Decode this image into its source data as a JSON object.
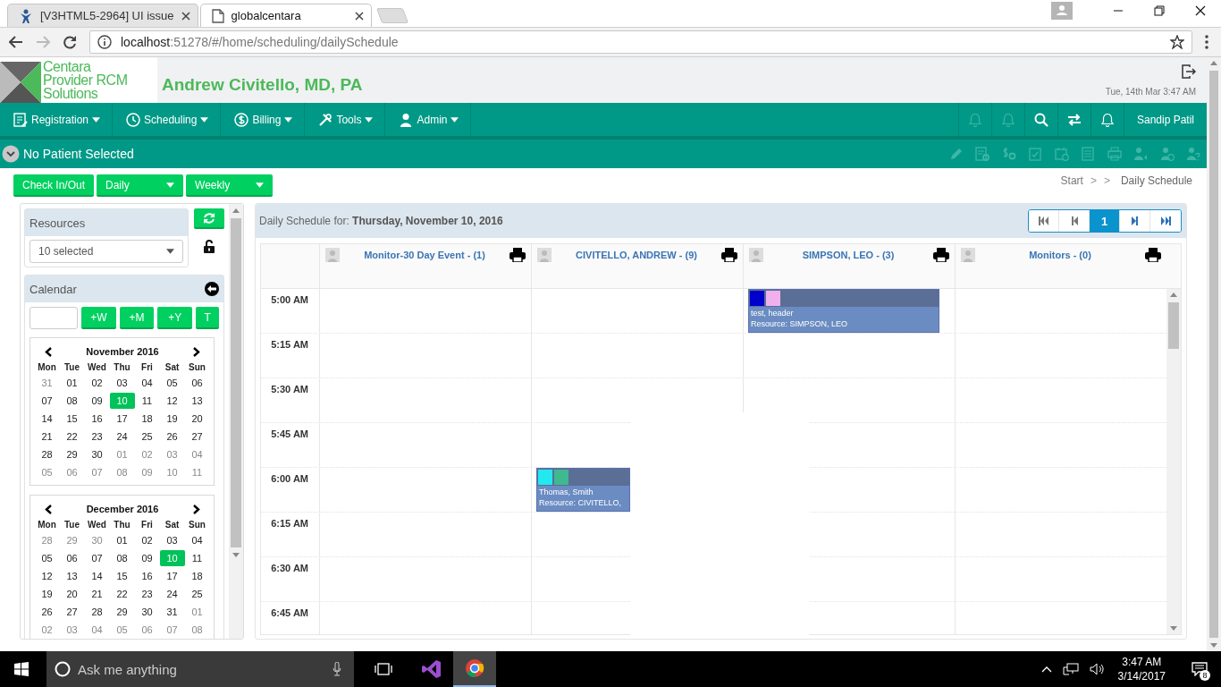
{
  "browser": {
    "tabs": [
      {
        "title": "[V3HTML5-2964] UI issue",
        "selected": false
      },
      {
        "title": "globalcentara",
        "selected": true
      }
    ],
    "url_host": "localhost",
    "url_path": ":51278/#/home/scheduling/dailySchedule"
  },
  "header": {
    "logo_lines": [
      "Centara",
      "Provider RCM",
      "Solutions"
    ],
    "practice": "Andrew Civitello, MD, PA",
    "datetime": "Tue, 14th Mar 3:47 AM"
  },
  "nav": {
    "menus": [
      {
        "label": "Registration"
      },
      {
        "label": "Scheduling"
      },
      {
        "label": "Billing"
      },
      {
        "label": "Tools"
      },
      {
        "label": "Admin"
      }
    ],
    "user": "Sandip Patil"
  },
  "patient_bar": {
    "text": "No Patient Selected"
  },
  "toolbar": {
    "button": "Check In/Out",
    "views": [
      {
        "label": "Daily"
      },
      {
        "label": "Weekly"
      }
    ]
  },
  "breadcrumbs": [
    {
      "kind": "link",
      "text": "Start"
    },
    {
      "kind": "sep",
      "text": ">"
    },
    {
      "kind": "sep",
      "text": ">"
    },
    {
      "kind": "current",
      "text": "Daily Schedule"
    }
  ],
  "resources": {
    "title": "Resources",
    "value": "10 selected"
  },
  "calendar": {
    "title": "Calendar",
    "quick_buttons": [
      "+W",
      "+M",
      "+Y",
      "T"
    ],
    "months": [
      {
        "title": "November 2016",
        "weekdays": [
          "Mon",
          "Tue",
          "Wed",
          "Thu",
          "Fri",
          "Sat",
          "Sun"
        ],
        "weeks": [
          [
            {
              "day": "31",
              "outside": true,
              "selected": false
            },
            {
              "day": "01",
              "outside": false,
              "selected": false
            },
            {
              "day": "02",
              "outside": false,
              "selected": false
            },
            {
              "day": "03",
              "outside": false,
              "selected": false
            },
            {
              "day": "04",
              "outside": false,
              "selected": false
            },
            {
              "day": "05",
              "outside": false,
              "selected": false
            },
            {
              "day": "06",
              "outside": false,
              "selected": false
            }
          ],
          [
            {
              "day": "07",
              "outside": false,
              "selected": false
            },
            {
              "day": "08",
              "outside": false,
              "selected": false
            },
            {
              "day": "09",
              "outside": false,
              "selected": false
            },
            {
              "day": "10",
              "outside": false,
              "selected": true
            },
            {
              "day": "11",
              "outside": false,
              "selected": false
            },
            {
              "day": "12",
              "outside": false,
              "selected": false
            },
            {
              "day": "13",
              "outside": false,
              "selected": false
            }
          ],
          [
            {
              "day": "14",
              "outside": false,
              "selected": false
            },
            {
              "day": "15",
              "outside": false,
              "selected": false
            },
            {
              "day": "16",
              "outside": false,
              "selected": false
            },
            {
              "day": "17",
              "outside": false,
              "selected": false
            },
            {
              "day": "18",
              "outside": false,
              "selected": false
            },
            {
              "day": "19",
              "outside": false,
              "selected": false
            },
            {
              "day": "20",
              "outside": false,
              "selected": false
            }
          ],
          [
            {
              "day": "21",
              "outside": false,
              "selected": false
            },
            {
              "day": "22",
              "outside": false,
              "selected": false
            },
            {
              "day": "23",
              "outside": false,
              "selected": false
            },
            {
              "day": "24",
              "outside": false,
              "selected": false
            },
            {
              "day": "25",
              "outside": false,
              "selected": false
            },
            {
              "day": "26",
              "outside": false,
              "selected": false
            },
            {
              "day": "27",
              "outside": false,
              "selected": false
            }
          ],
          [
            {
              "day": "28",
              "outside": false,
              "selected": false
            },
            {
              "day": "29",
              "outside": false,
              "selected": false
            },
            {
              "day": "30",
              "outside": false,
              "selected": false
            },
            {
              "day": "01",
              "outside": true,
              "selected": false
            },
            {
              "day": "02",
              "outside": true,
              "selected": false
            },
            {
              "day": "03",
              "outside": true,
              "selected": false
            },
            {
              "day": "04",
              "outside": true,
              "selected": false
            }
          ],
          [
            {
              "day": "05",
              "outside": true,
              "selected": false
            },
            {
              "day": "06",
              "outside": true,
              "selected": false
            },
            {
              "day": "07",
              "outside": true,
              "selected": false
            },
            {
              "day": "08",
              "outside": true,
              "selected": false
            },
            {
              "day": "09",
              "outside": true,
              "selected": false
            },
            {
              "day": "10",
              "outside": true,
              "selected": false
            },
            {
              "day": "11",
              "outside": true,
              "selected": false
            }
          ]
        ]
      },
      {
        "title": "December 2016",
        "weekdays": [
          "Mon",
          "Tue",
          "Wed",
          "Thu",
          "Fri",
          "Sat",
          "Sun"
        ],
        "weeks": [
          [
            {
              "day": "28",
              "outside": true,
              "selected": false
            },
            {
              "day": "29",
              "outside": true,
              "selected": false
            },
            {
              "day": "30",
              "outside": true,
              "selected": false
            },
            {
              "day": "01",
              "outside": false,
              "selected": false
            },
            {
              "day": "02",
              "outside": false,
              "selected": false
            },
            {
              "day": "03",
              "outside": false,
              "selected": false
            },
            {
              "day": "04",
              "outside": false,
              "selected": false
            }
          ],
          [
            {
              "day": "05",
              "outside": false,
              "selected": false
            },
            {
              "day": "06",
              "outside": false,
              "selected": false
            },
            {
              "day": "07",
              "outside": false,
              "selected": false
            },
            {
              "day": "08",
              "outside": false,
              "selected": false
            },
            {
              "day": "09",
              "outside": false,
              "selected": false
            },
            {
              "day": "10",
              "outside": false,
              "selected": true
            },
            {
              "day": "11",
              "outside": false,
              "selected": false
            }
          ],
          [
            {
              "day": "12",
              "outside": false,
              "selected": false
            },
            {
              "day": "13",
              "outside": false,
              "selected": false
            },
            {
              "day": "14",
              "outside": false,
              "selected": false
            },
            {
              "day": "15",
              "outside": false,
              "selected": false
            },
            {
              "day": "16",
              "outside": false,
              "selected": false
            },
            {
              "day": "17",
              "outside": false,
              "selected": false
            },
            {
              "day": "18",
              "outside": false,
              "selected": false
            }
          ],
          [
            {
              "day": "19",
              "outside": false,
              "selected": false
            },
            {
              "day": "20",
              "outside": false,
              "selected": false
            },
            {
              "day": "21",
              "outside": false,
              "selected": false
            },
            {
              "day": "22",
              "outside": false,
              "selected": false
            },
            {
              "day": "23",
              "outside": false,
              "selected": false
            },
            {
              "day": "24",
              "outside": false,
              "selected": false
            },
            {
              "day": "25",
              "outside": false,
              "selected": false
            }
          ],
          [
            {
              "day": "26",
              "outside": false,
              "selected": false
            },
            {
              "day": "27",
              "outside": false,
              "selected": false
            },
            {
              "day": "28",
              "outside": false,
              "selected": false
            },
            {
              "day": "29",
              "outside": false,
              "selected": false
            },
            {
              "day": "30",
              "outside": false,
              "selected": false
            },
            {
              "day": "31",
              "outside": false,
              "selected": false
            },
            {
              "day": "01",
              "outside": true,
              "selected": false
            }
          ],
          [
            {
              "day": "02",
              "outside": true,
              "selected": false
            },
            {
              "day": "03",
              "outside": true,
              "selected": false
            },
            {
              "day": "04",
              "outside": true,
              "selected": false
            },
            {
              "day": "05",
              "outside": true,
              "selected": false
            },
            {
              "day": "06",
              "outside": true,
              "selected": false
            },
            {
              "day": "07",
              "outside": true,
              "selected": false
            },
            {
              "day": "08",
              "outside": true,
              "selected": false
            }
          ]
        ]
      }
    ]
  },
  "schedule": {
    "title": "Daily Schedule for: **Thursday, November 10, 2016**",
    "pages": [
      {
        "label": "1",
        "selected": true
      }
    ],
    "columns": [
      {
        "name": "Monitor-30 Day Event - (1)"
      },
      {
        "name": "CIVITELLO, ANDREW - (9)"
      },
      {
        "name": "SIMPSON, LEO - (3)"
      },
      {
        "name": "Monitors - (0)"
      }
    ],
    "rows": [
      {
        "time": "5:00 AM",
        "cells": [
          {},
          {},
          {
            "appointment": {
              "swatches": [
                {
                  "color": "#0000cc"
                },
                {
                  "color": "#f0b0ee"
                }
              ],
              "title": "test, header",
              "resource": "Resource: SIMPSON, LEO"
            }
          },
          {}
        ]
      },
      {
        "time": "5:15 AM",
        "cells": [
          {},
          {},
          {},
          {}
        ]
      },
      {
        "time": "5:30 AM",
        "cells": [
          {},
          {},
          {},
          {}
        ]
      },
      {
        "time": "5:45 AM",
        "cells": [
          {},
          {},
          {},
          {}
        ]
      },
      {
        "time": "6:00 AM",
        "cells": [
          {},
          {
            "appointment": {
              "swatches": [
                {
                  "color": "#22e8f0"
                },
                {
                  "color": "#40b890"
                }
              ],
              "title": "Thomas, Smith",
              "resource": "Resource: CIVITELLO,"
            }
          },
          {},
          {}
        ]
      },
      {
        "time": "6:15 AM",
        "cells": [
          {},
          {},
          {},
          {}
        ]
      },
      {
        "time": "6:30 AM",
        "cells": [
          {},
          {},
          {},
          {}
        ]
      },
      {
        "time": "6:45 AM",
        "cells": [
          {},
          {},
          {},
          {}
        ]
      }
    ]
  },
  "taskbar": {
    "search_placeholder": "Ask me anything",
    "time": "3:47 AM",
    "date": "3/14/2017",
    "notifications": "8"
  }
}
